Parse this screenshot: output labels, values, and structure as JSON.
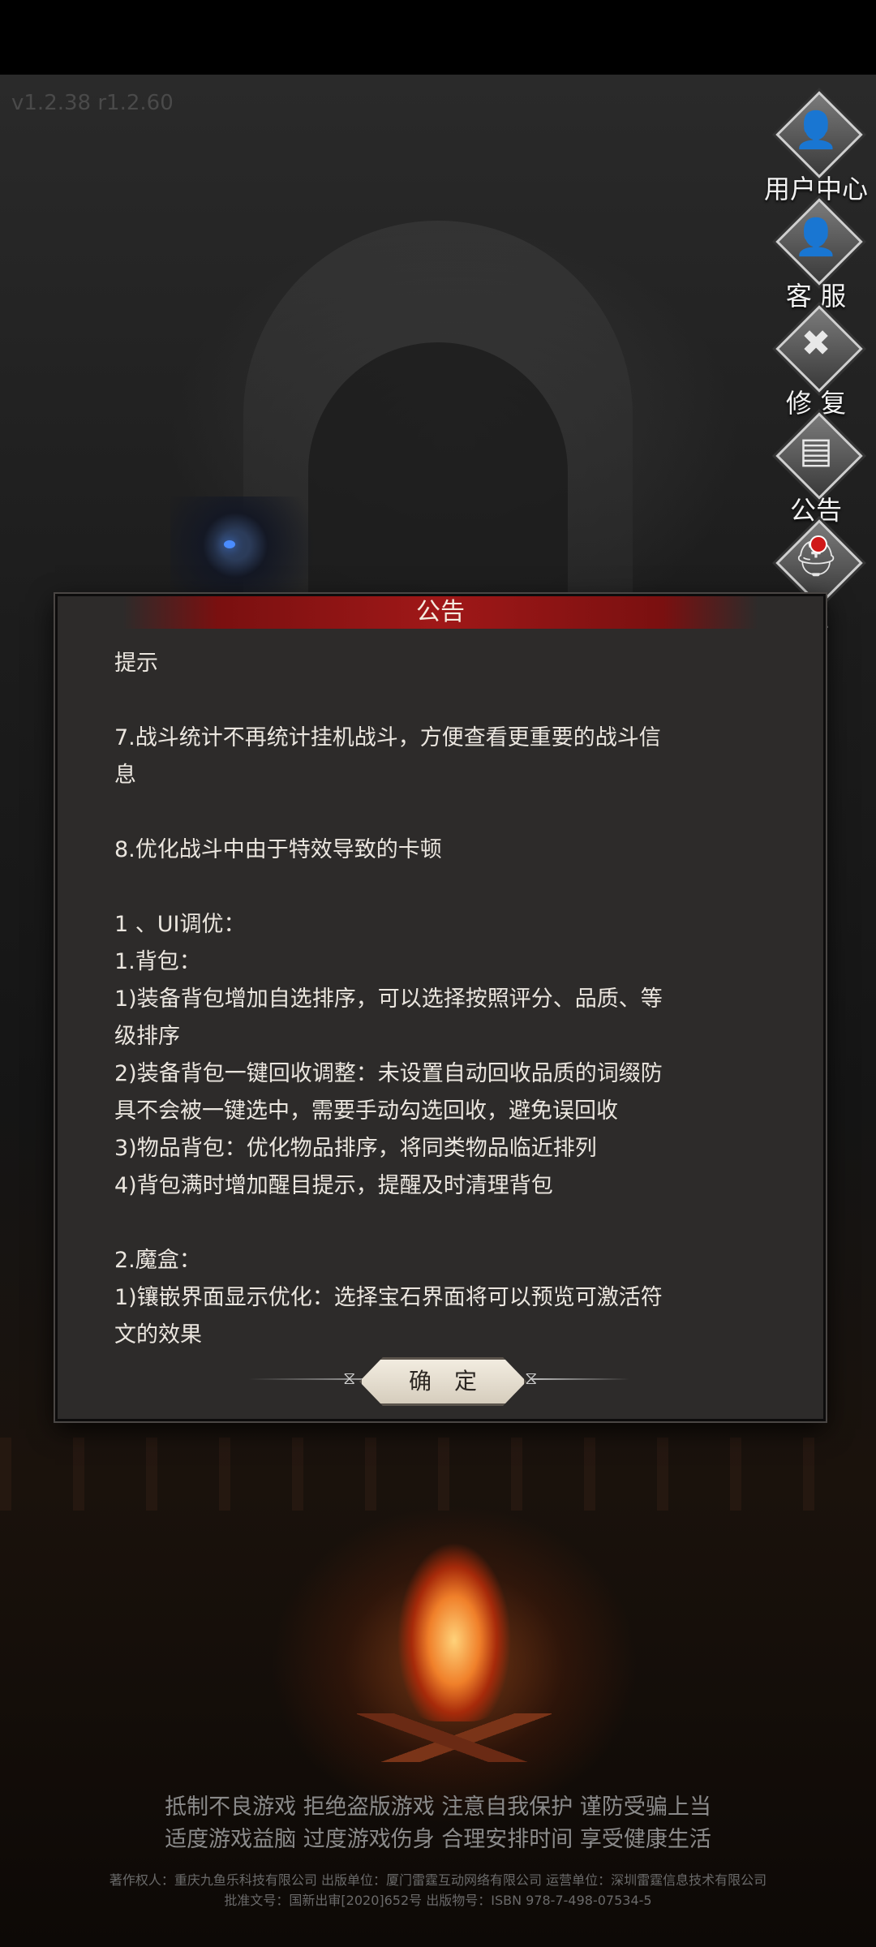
{
  "version": "v1.2.38 r1.2.60",
  "sidebar": {
    "items": [
      {
        "label": "用户中心",
        "icon": "user-icon",
        "glyph": "👤"
      },
      {
        "label": "客 服",
        "icon": "customer-service-icon",
        "glyph": "👤"
      },
      {
        "label": "修 复",
        "icon": "repair-icon",
        "glyph": "✖"
      },
      {
        "label": "公告",
        "icon": "notice-icon",
        "glyph": "▤"
      },
      {
        "label": "区",
        "icon": "server-icon",
        "glyph": "⛑"
      }
    ]
  },
  "dialog": {
    "title": "公告",
    "lines": [
      "提示",
      "",
      "7.战斗统计不再统计挂机战斗，方便查看更重要的战斗信",
      "息",
      "",
      "8.优化战斗中由于特效导致的卡顿",
      "",
      "1 、UI调优：",
      "1.背包：",
      "1)装备背包增加自选排序，可以选择按照评分、品质、等",
      "级排序",
      "2)装备背包一键回收调整：未设置自动回收品质的词缀防",
      "具不会被一键选中，需要手动勾选回收，避免误回收",
      "3)物品背包：优化物品排序，将同类物品临近排列",
      "4)背包满时增加醒目提示，提醒及时清理背包",
      "",
      "2.魔盒：",
      "1)镶嵌界面显示优化：选择宝石界面将可以预览可激活符",
      "文的效果"
    ],
    "confirm_label": "确定"
  },
  "footer": {
    "line1": "抵制不良游戏 拒绝盗版游戏 注意自我保护 谨防受骗上当",
    "line2": "适度游戏益脑 过度游戏伤身 合理安排时间 享受健康生活",
    "line3": "著作权人：重庆九鱼乐科技有限公司 出版单位：厦门雷霆互动网络有限公司 运营单位：深圳雷霆信息技术有限公司",
    "line4": "批准文号：国新出审[2020]652号 出版物号：ISBN 978-7-498-07534-5"
  }
}
